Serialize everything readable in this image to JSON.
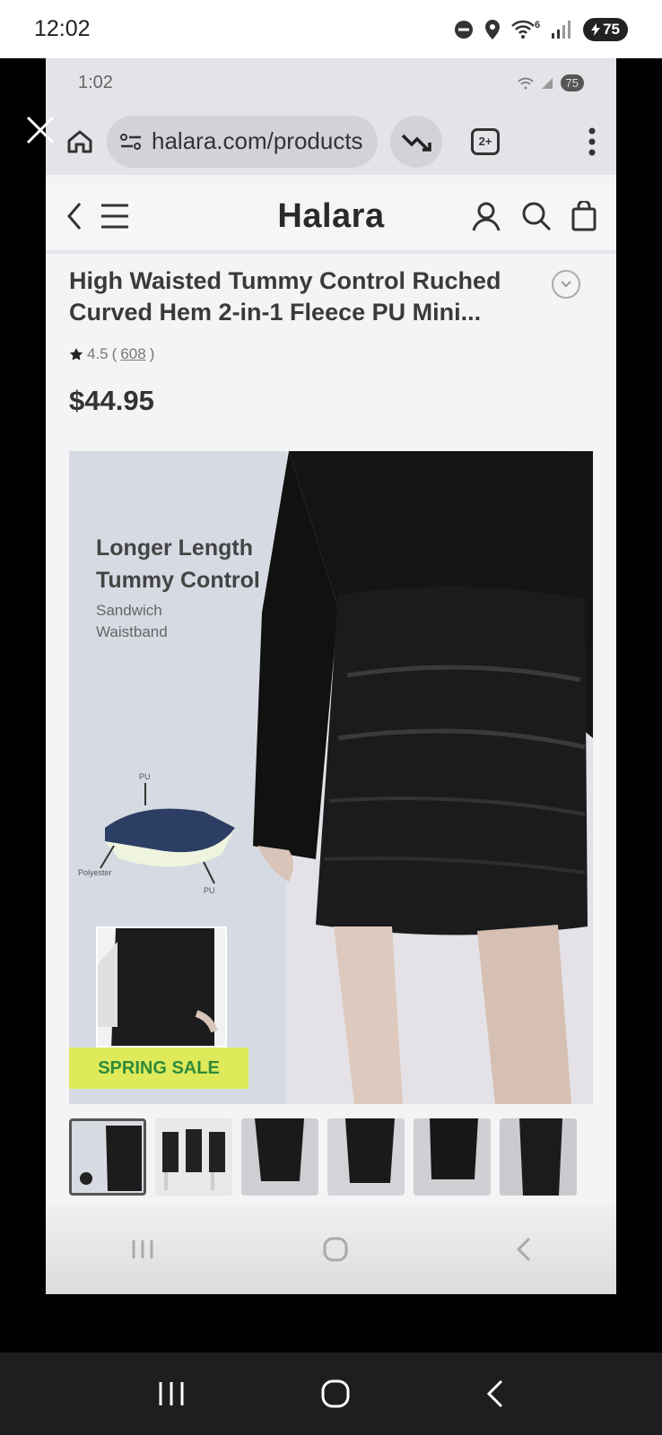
{
  "status_bar": {
    "time": "12:02",
    "wifi_badge": "6",
    "battery": "75"
  },
  "viewer": {
    "close_icon": "close-icon"
  },
  "inner_status": {
    "time": "1:02",
    "battery": "75"
  },
  "browser": {
    "url": "halara.com/products",
    "tabs_count": "2+"
  },
  "site": {
    "brand": "Halara"
  },
  "product": {
    "title": "High Waisted Tummy Control Ruched Curved Hem 2-in-1 Fleece PU Mini...",
    "rating": "4.5",
    "rating_open": "(",
    "review_count": "608",
    "rating_close": ")",
    "price": "$44.95"
  },
  "hero": {
    "headline_line1": "Longer Length",
    "headline_line2": "Tummy Control",
    "sub_line1": "Sandwich",
    "sub_line2": "Waistband",
    "label_top": "PU",
    "label_left": "Polyester",
    "label_bottom": "PU",
    "sale_badge": "SPRING SALE"
  },
  "thumbnails": [
    "thumb-1",
    "thumb-2",
    "thumb-3",
    "thumb-4",
    "thumb-5",
    "thumb-6"
  ],
  "colors": {
    "sale_badge_bg": "#dfea5a",
    "sale_badge_text": "#2f8a3a",
    "system_nav_bg": "#1e1e20"
  }
}
